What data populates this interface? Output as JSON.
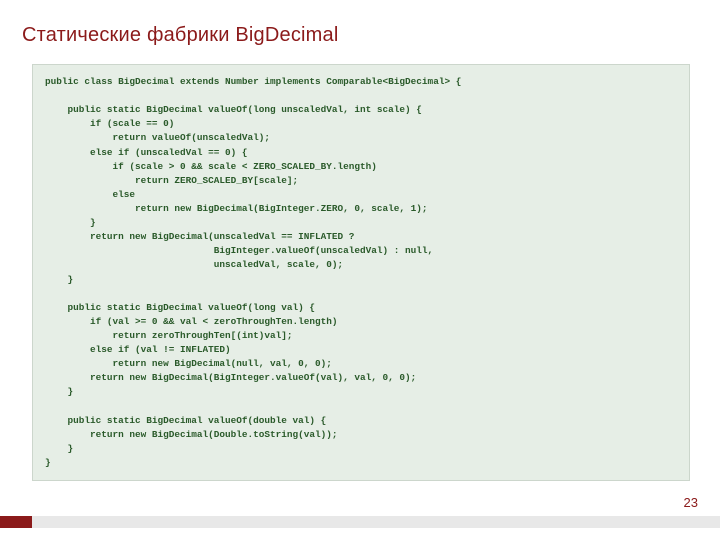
{
  "title": "Статические фабрики BigDecimal",
  "page_number": "23",
  "code": "public class BigDecimal extends Number implements Comparable<BigDecimal> {\n\n    public static BigDecimal valueOf(long unscaledVal, int scale) {\n        if (scale == 0)\n            return valueOf(unscaledVal);\n        else if (unscaledVal == 0) {\n            if (scale > 0 && scale < ZERO_SCALED_BY.length)\n                return ZERO_SCALED_BY[scale];\n            else\n                return new BigDecimal(BigInteger.ZERO, 0, scale, 1);\n        }\n        return new BigDecimal(unscaledVal == INFLATED ?\n                              BigInteger.valueOf(unscaledVal) : null,\n                              unscaledVal, scale, 0);\n    }\n\n    public static BigDecimal valueOf(long val) {\n        if (val >= 0 && val < zeroThroughTen.length)\n            return zeroThroughTen[(int)val];\n        else if (val != INFLATED)\n            return new BigDecimal(null, val, 0, 0);\n        return new BigDecimal(BigInteger.valueOf(val), val, 0, 0);\n    }\n\n    public static BigDecimal valueOf(double val) {\n        return new BigDecimal(Double.toString(val));\n    }\n}"
}
